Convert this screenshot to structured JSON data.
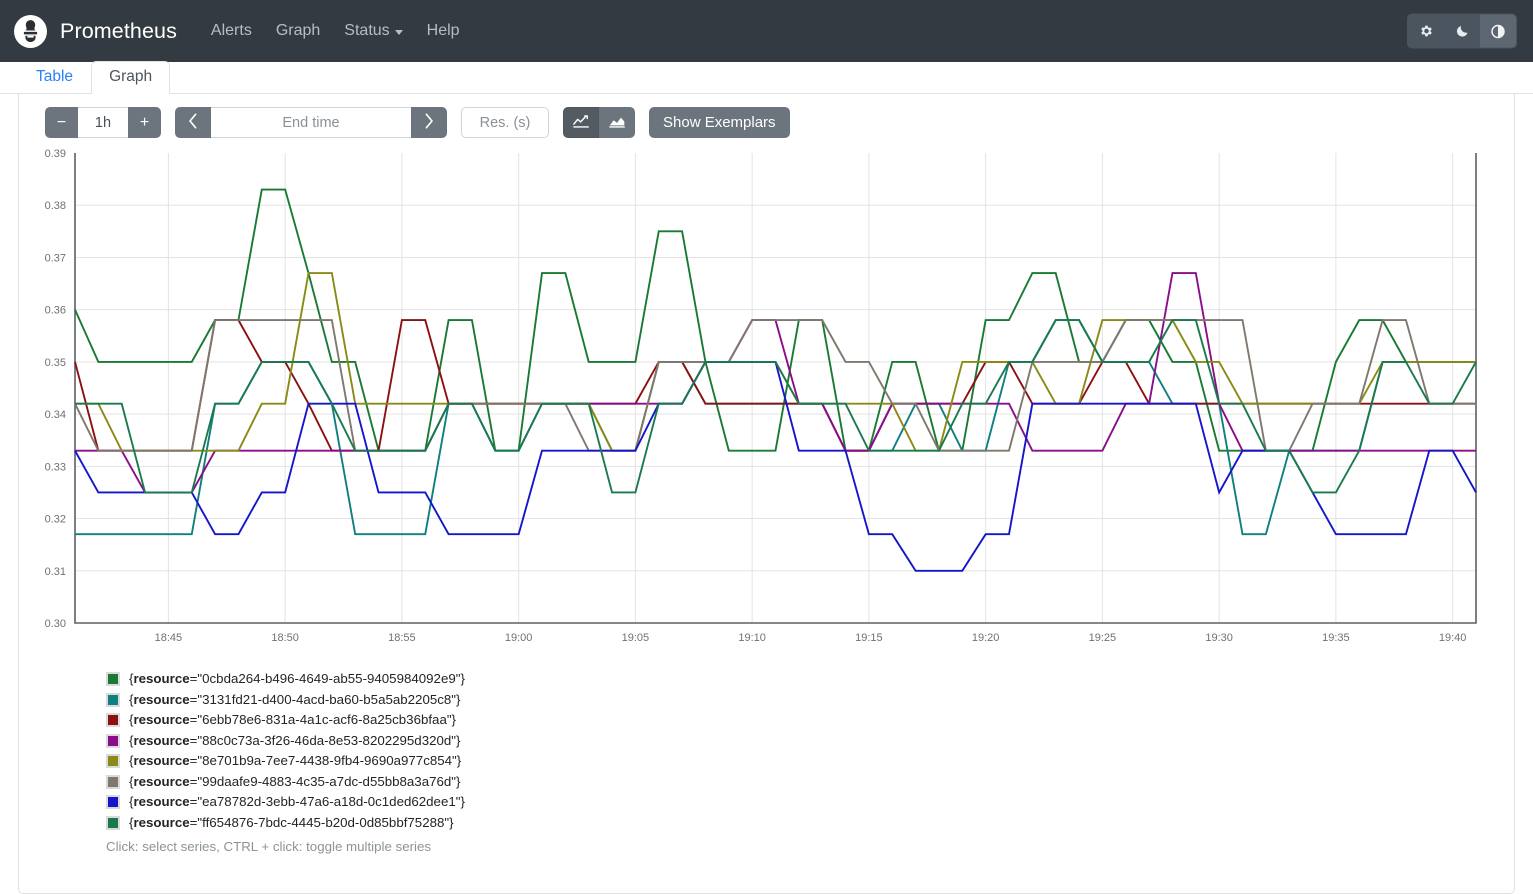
{
  "navbar": {
    "brand": "Prometheus",
    "logo_icon": "prometheus-logo-icon",
    "links": [
      {
        "label": "Alerts",
        "name": "alerts",
        "dropdown": false
      },
      {
        "label": "Graph",
        "name": "graph",
        "dropdown": false
      },
      {
        "label": "Status",
        "name": "status",
        "dropdown": true
      },
      {
        "label": "Help",
        "name": "help",
        "dropdown": false
      }
    ],
    "theme_buttons": [
      {
        "icon": "gear-icon",
        "name": "theme-light-button",
        "active": false
      },
      {
        "icon": "moon-icon",
        "name": "theme-dark-button",
        "active": false
      },
      {
        "icon": "half-circle-icon",
        "name": "theme-auto-button",
        "active": true
      }
    ]
  },
  "tabs": [
    {
      "label": "Table",
      "active": false
    },
    {
      "label": "Graph",
      "active": true
    }
  ],
  "toolbar": {
    "range_decrease_label": "−",
    "range_value": "1h",
    "range_increase_label": "+",
    "time_back_icon": "chevron-left-icon",
    "end_time_placeholder": "End time",
    "end_time_value": "",
    "time_forward_icon": "chevron-right-icon",
    "resolution_placeholder": "Res. (s)",
    "resolution_value": "",
    "chart_type_line_icon": "line-chart-icon",
    "chart_type_stacked_icon": "stacked-area-chart-icon",
    "chart_type_active": "line",
    "show_exemplars_label": "Show Exemplars"
  },
  "legend": {
    "hint": "Click: select series, CTRL + click: toggle multiple series",
    "label_prefix": "{",
    "label_key": "resource",
    "label_eq": "=\"",
    "label_suffix": "\"}"
  },
  "chart_data": {
    "type": "line",
    "title": "",
    "xlabel": "",
    "ylabel": "",
    "grid": true,
    "legend_position": "bottom-left",
    "ylim": [
      0.3,
      0.39
    ],
    "yticks": [
      "0.30",
      "0.31",
      "0.32",
      "0.33",
      "0.34",
      "0.35",
      "0.36",
      "0.37",
      "0.38",
      "0.39"
    ],
    "ytick_values": [
      0.3,
      0.31,
      0.32,
      0.33,
      0.34,
      0.35,
      0.36,
      0.37,
      0.38,
      0.39
    ],
    "xticks": [
      "18:45",
      "18:50",
      "18:55",
      "19:00",
      "19:05",
      "19:10",
      "19:15",
      "19:20",
      "19:25",
      "19:30",
      "19:35",
      "19:40"
    ],
    "xtick_values": [
      1125,
      1130,
      1135,
      1140,
      1145,
      1150,
      1155,
      1160,
      1165,
      1170,
      1175,
      1180
    ],
    "xlim": [
      1121,
      1181
    ],
    "x": [
      1121,
      1122,
      1123,
      1124,
      1125,
      1126,
      1127,
      1128,
      1129,
      1130,
      1131,
      1132,
      1133,
      1134,
      1135,
      1136,
      1137,
      1138,
      1139,
      1140,
      1141,
      1142,
      1143,
      1144,
      1145,
      1146,
      1147,
      1148,
      1149,
      1150,
      1151,
      1152,
      1153,
      1154,
      1155,
      1156,
      1157,
      1158,
      1159,
      1160,
      1161,
      1162,
      1163,
      1164,
      1165,
      1166,
      1167,
      1168,
      1169,
      1170,
      1171,
      1172,
      1173,
      1174,
      1175,
      1176,
      1177,
      1178,
      1179,
      1180,
      1181
    ],
    "series": [
      {
        "name": "{resource=\"0cbda264-b496-4649-ab55-9405984092e9\"}",
        "resource": "0cbda264-b496-4649-ab55-9405984092e9",
        "color": "#1a7a33",
        "values": [
          0.36,
          0.35,
          0.35,
          0.35,
          0.35,
          0.35,
          0.358,
          0.358,
          0.383,
          0.383,
          0.367,
          0.35,
          0.35,
          0.333,
          0.333,
          0.333,
          0.358,
          0.358,
          0.333,
          0.333,
          0.367,
          0.367,
          0.35,
          0.35,
          0.35,
          0.375,
          0.375,
          0.35,
          0.333,
          0.333,
          0.333,
          0.358,
          0.358,
          0.333,
          0.333,
          0.35,
          0.35,
          0.333,
          0.333,
          0.358,
          0.358,
          0.367,
          0.367,
          0.35,
          0.35,
          0.358,
          0.358,
          0.35,
          0.35,
          0.333,
          0.333,
          0.333,
          0.333,
          0.333,
          0.35,
          0.358,
          0.358,
          0.35,
          0.35,
          0.35,
          0.35
        ]
      },
      {
        "name": "{resource=\"3131fd21-d400-4acd-ba60-b5a5ab2205c8\"}",
        "resource": "3131fd21-d400-4acd-ba60-b5a5ab2205c8",
        "color": "#0f7f7f",
        "color_alt": "#1b9e9e",
        "values": [
          0.317,
          0.317,
          0.317,
          0.317,
          0.317,
          0.317,
          0.342,
          0.342,
          0.35,
          0.35,
          0.35,
          0.342,
          0.317,
          0.317,
          0.317,
          0.317,
          0.342,
          0.342,
          0.333,
          0.333,
          0.342,
          0.342,
          0.342,
          0.333,
          0.333,
          0.35,
          0.35,
          0.342,
          0.342,
          0.342,
          0.342,
          0.342,
          0.342,
          0.333,
          0.333,
          0.333,
          0.342,
          0.342,
          0.333,
          0.333,
          0.35,
          0.35,
          0.358,
          0.358,
          0.35,
          0.35,
          0.35,
          0.342,
          0.342,
          0.342,
          0.317,
          0.317,
          0.333,
          0.333,
          0.333,
          0.333,
          0.35,
          0.35,
          0.35,
          0.35,
          0.35
        ]
      },
      {
        "name": "{resource=\"6ebb78e6-831a-4a1c-acf6-8a25cb36bfaa\"}",
        "resource": "6ebb78e6-831a-4a1c-acf6-8a25cb36bfaa",
        "color": "#8b1113",
        "values": [
          0.35,
          0.333,
          0.333,
          0.333,
          0.333,
          0.333,
          0.358,
          0.358,
          0.35,
          0.35,
          0.342,
          0.333,
          0.333,
          0.333,
          0.358,
          0.358,
          0.342,
          0.342,
          0.342,
          0.342,
          0.342,
          0.342,
          0.342,
          0.342,
          0.342,
          0.35,
          0.35,
          0.342,
          0.342,
          0.342,
          0.342,
          0.342,
          0.342,
          0.333,
          0.333,
          0.342,
          0.342,
          0.342,
          0.342,
          0.35,
          0.35,
          0.342,
          0.342,
          0.342,
          0.35,
          0.35,
          0.342,
          0.342,
          0.342,
          0.342,
          0.342,
          0.342,
          0.342,
          0.342,
          0.342,
          0.342,
          0.342,
          0.342,
          0.342,
          0.342,
          0.342
        ]
      },
      {
        "name": "{resource=\"88c0c73a-3f26-46da-8e53-8202295d320d\"}",
        "resource": "88c0c73a-3f26-46da-8e53-8202295d320d",
        "color": "#8a0d8a",
        "values": [
          0.333,
          0.333,
          0.333,
          0.325,
          0.325,
          0.325,
          0.333,
          0.333,
          0.333,
          0.333,
          0.333,
          0.333,
          0.333,
          0.333,
          0.333,
          0.333,
          0.342,
          0.342,
          0.342,
          0.342,
          0.342,
          0.342,
          0.342,
          0.342,
          0.342,
          0.342,
          0.342,
          0.35,
          0.35,
          0.358,
          0.358,
          0.342,
          0.342,
          0.333,
          0.333,
          0.342,
          0.342,
          0.342,
          0.342,
          0.342,
          0.342,
          0.333,
          0.333,
          0.333,
          0.333,
          0.342,
          0.342,
          0.367,
          0.367,
          0.342,
          0.333,
          0.333,
          0.333,
          0.333,
          0.333,
          0.333,
          0.333,
          0.333,
          0.333,
          0.333,
          0.333
        ]
      },
      {
        "name": "{resource=\"8e701b9a-7ee7-4438-9fb4-9690a977c854\"}",
        "resource": "8e701b9a-7ee7-4438-9fb4-9690a977c854",
        "color": "#8a8a17",
        "values": [
          0.342,
          0.342,
          0.333,
          0.333,
          0.333,
          0.333,
          0.333,
          0.333,
          0.342,
          0.342,
          0.367,
          0.367,
          0.342,
          0.342,
          0.342,
          0.342,
          0.342,
          0.342,
          0.342,
          0.342,
          0.342,
          0.342,
          0.342,
          0.333,
          0.333,
          0.35,
          0.35,
          0.35,
          0.35,
          0.35,
          0.35,
          0.342,
          0.342,
          0.342,
          0.342,
          0.342,
          0.333,
          0.333,
          0.35,
          0.35,
          0.35,
          0.35,
          0.342,
          0.342,
          0.358,
          0.358,
          0.358,
          0.358,
          0.35,
          0.35,
          0.342,
          0.342,
          0.342,
          0.342,
          0.342,
          0.342,
          0.35,
          0.35,
          0.35,
          0.35,
          0.35
        ]
      },
      {
        "name": "{resource=\"99daafe9-4883-4c35-a7dc-d55bb8a3a76d\"}",
        "resource": "99daafe9-4883-4c35-a7dc-d55bb8a3a76d",
        "color": "#80786e",
        "values": [
          0.342,
          0.333,
          0.333,
          0.333,
          0.333,
          0.333,
          0.358,
          0.358,
          0.358,
          0.358,
          0.358,
          0.358,
          0.333,
          0.333,
          0.333,
          0.333,
          0.342,
          0.342,
          0.342,
          0.342,
          0.342,
          0.342,
          0.333,
          0.333,
          0.333,
          0.35,
          0.35,
          0.35,
          0.35,
          0.358,
          0.358,
          0.358,
          0.358,
          0.35,
          0.35,
          0.342,
          0.342,
          0.333,
          0.333,
          0.333,
          0.333,
          0.35,
          0.35,
          0.35,
          0.35,
          0.358,
          0.358,
          0.358,
          0.358,
          0.358,
          0.358,
          0.333,
          0.333,
          0.342,
          0.342,
          0.342,
          0.358,
          0.358,
          0.342,
          0.342,
          0.342
        ]
      },
      {
        "name": "{resource=\"ea78782d-3ebb-47a6-a18d-0c1ded62dee1\"}",
        "resource": "ea78782d-3ebb-47a6-a18d-0c1ded62dee1",
        "color": "#1515cc",
        "values": [
          0.333,
          0.325,
          0.325,
          0.325,
          0.325,
          0.325,
          0.317,
          0.317,
          0.325,
          0.325,
          0.342,
          0.342,
          0.342,
          0.325,
          0.325,
          0.325,
          0.317,
          0.317,
          0.317,
          0.317,
          0.333,
          0.333,
          0.333,
          0.333,
          0.333,
          0.342,
          0.342,
          0.35,
          0.35,
          0.35,
          0.35,
          0.333,
          0.333,
          0.333,
          0.317,
          0.317,
          0.31,
          0.31,
          0.31,
          0.317,
          0.317,
          0.342,
          0.342,
          0.342,
          0.342,
          0.342,
          0.342,
          0.342,
          0.342,
          0.325,
          0.333,
          0.333,
          0.333,
          0.325,
          0.317,
          0.317,
          0.317,
          0.317,
          0.333,
          0.333,
          0.325
        ]
      },
      {
        "name": "{resource=\"ff654876-7bdc-4445-b20d-0d85bbf75288\"}",
        "resource": "ff654876-7bdc-4445-b20d-0d85bbf75288",
        "color": "#1a7a4e",
        "values": [
          0.342,
          0.342,
          0.342,
          0.325,
          0.325,
          0.325,
          0.342,
          0.342,
          0.35,
          0.35,
          0.35,
          0.342,
          0.333,
          0.333,
          0.333,
          0.333,
          0.342,
          0.342,
          0.333,
          0.333,
          0.342,
          0.342,
          0.342,
          0.325,
          0.325,
          0.342,
          0.342,
          0.35,
          0.35,
          0.35,
          0.35,
          0.342,
          0.342,
          0.342,
          0.333,
          0.333,
          0.333,
          0.333,
          0.342,
          0.342,
          0.35,
          0.35,
          0.358,
          0.358,
          0.35,
          0.35,
          0.35,
          0.358,
          0.358,
          0.342,
          0.342,
          0.333,
          0.333,
          0.325,
          0.325,
          0.333,
          0.35,
          0.35,
          0.342,
          0.342,
          0.35
        ]
      }
    ]
  }
}
